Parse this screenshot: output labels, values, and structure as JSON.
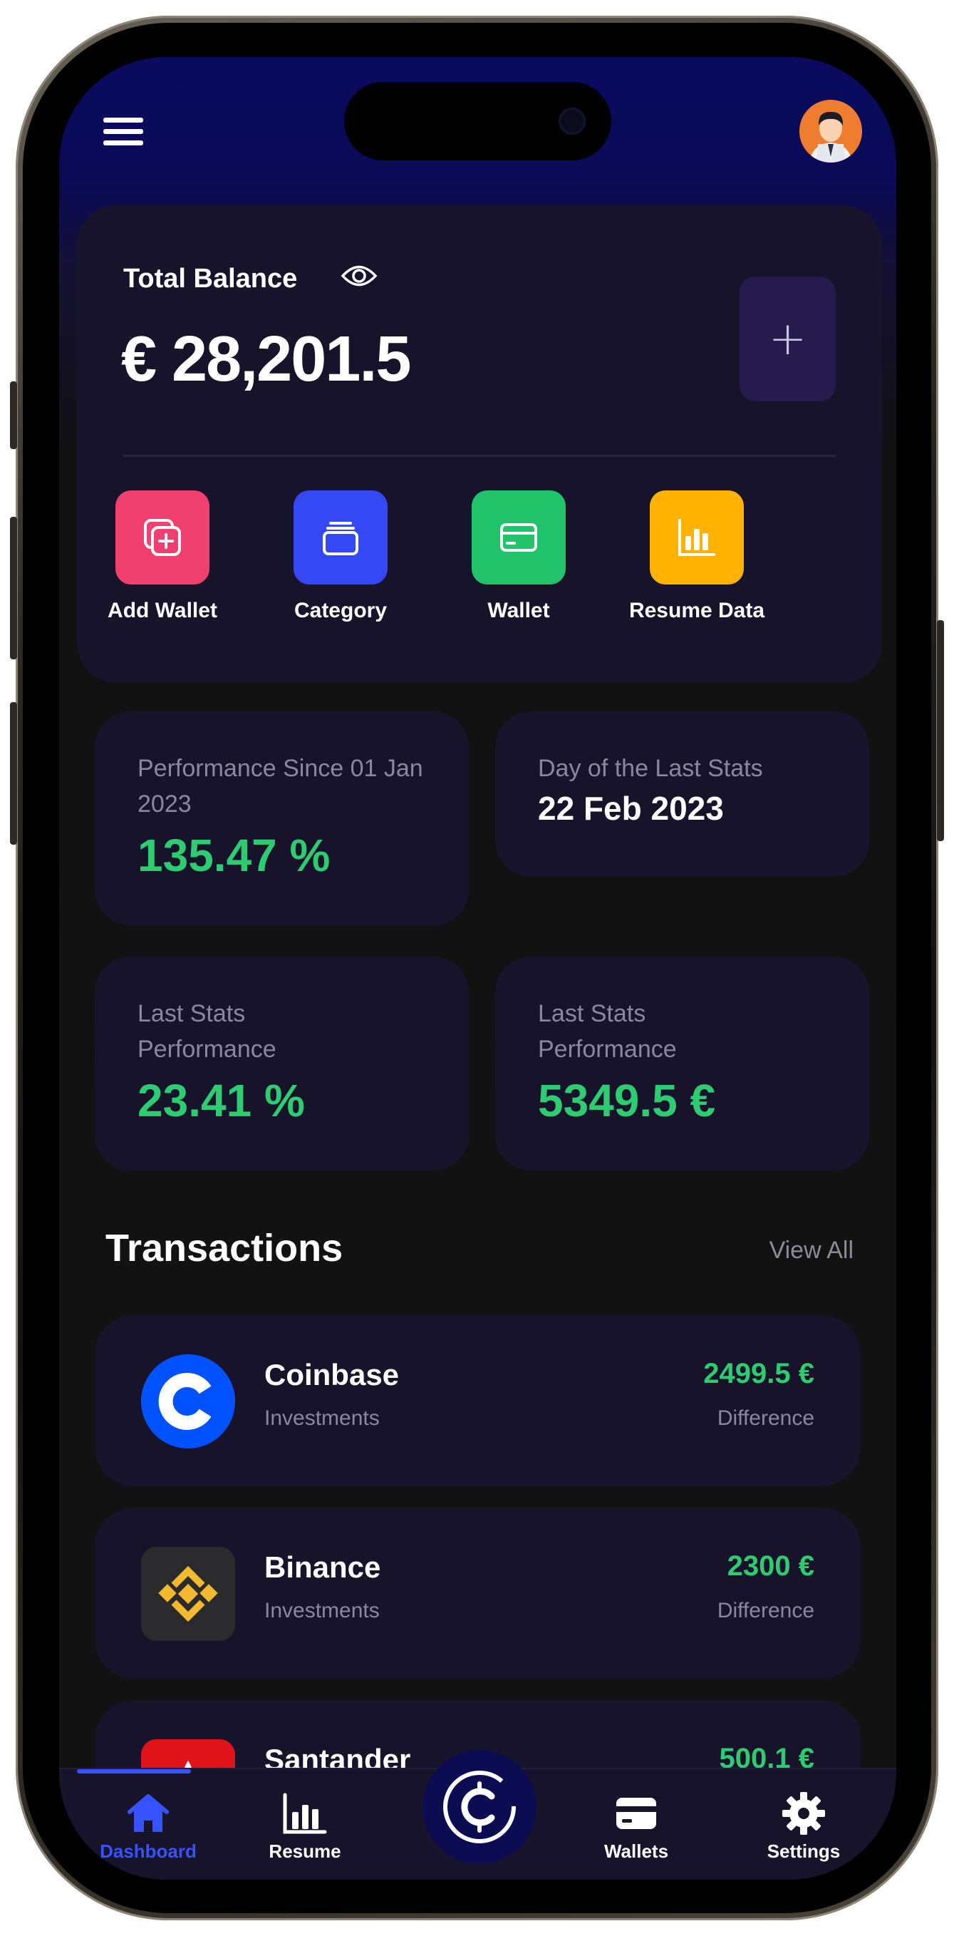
{
  "header": {
    "menu_icon": "hamburger-menu-icon",
    "avatar_icon": "user-avatar"
  },
  "balance": {
    "label": "Total Balance",
    "amount": "€ 28,201.5",
    "add_icon": "plus-icon"
  },
  "actions": [
    {
      "label": "Add Wallet",
      "icon": "add-wallet-icon",
      "color": "#f0406f"
    },
    {
      "label": "Category",
      "icon": "category-icon",
      "color": "#3548f5"
    },
    {
      "label": "Wallet",
      "icon": "wallet-card-icon",
      "color": "#21c46b"
    },
    {
      "label": "Resume Data",
      "icon": "bar-chart-icon",
      "color": "#ffb300"
    }
  ],
  "stats": [
    {
      "title": "Performance Since 01 Jan 2023",
      "value": "135.47 %"
    },
    {
      "title": "Day of the Last Stats",
      "value": "22 Feb 2023"
    },
    {
      "title": "Last Stats Performance",
      "value": "23.41 %"
    },
    {
      "title": "Last Stats Performance",
      "value": "5349.5 €"
    }
  ],
  "transactions": {
    "title": "Transactions",
    "view_all": "View All",
    "items": [
      {
        "name": "Coinbase",
        "category": "Investments",
        "amount": "2499.5 €",
        "amount_label": "Difference",
        "logo": "coinbase-logo"
      },
      {
        "name": "Binance",
        "category": "Investments",
        "amount": "2300 €",
        "amount_label": "Difference",
        "logo": "binance-logo"
      },
      {
        "name": "Santander",
        "category": "",
        "amount": "500.1 €",
        "amount_label": "",
        "logo": "santander-logo"
      }
    ]
  },
  "nav": {
    "items": [
      {
        "label": "Dashboard",
        "icon": "home-icon",
        "active": true
      },
      {
        "label": "Resume",
        "icon": "bar-chart-icon"
      },
      {
        "label": "Wallets",
        "icon": "wallet-card-icon"
      },
      {
        "label": "Settings",
        "icon": "gear-icon"
      }
    ],
    "center_icon": "app-logo-icon",
    "active_color": "#3752ff"
  },
  "colors": {
    "positive": "#2ecc71",
    "card_bg": "#17132b",
    "header_bg": "#0a0a60"
  }
}
